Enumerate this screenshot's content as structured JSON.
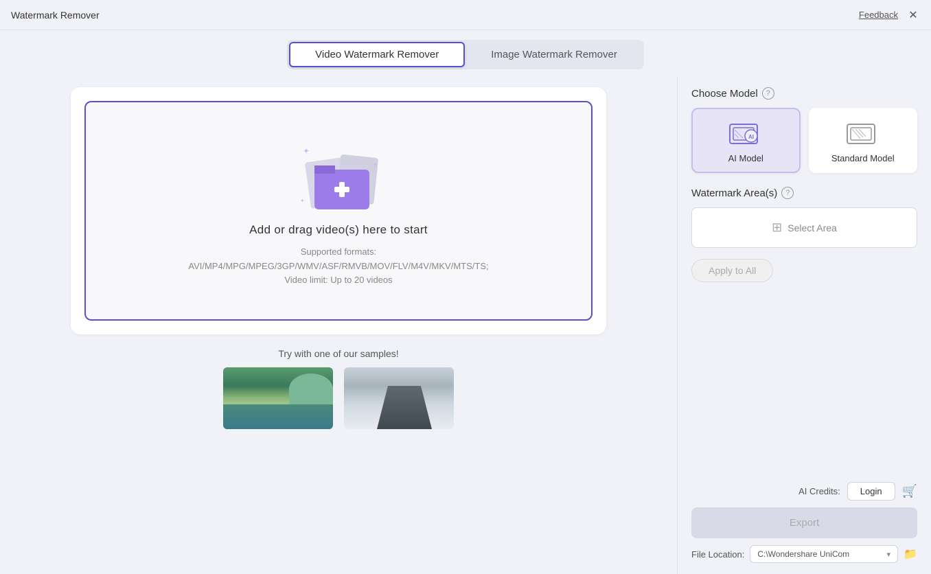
{
  "titleBar": {
    "title": "Watermark Remover",
    "feedback": "Feedback",
    "close": "✕"
  },
  "tabs": {
    "video": "Video Watermark Remover",
    "image": "Image Watermark Remover"
  },
  "activeTab": "video",
  "uploadZone": {
    "title": "Add or drag video(s) here to start",
    "formats_line1": "Supported formats:",
    "formats_line2": "AVI/MP4/MPG/MPEG/3GP/WMV/ASF/RMVB/MOV/FLV/M4V/MKV/MTS/TS;",
    "formats_line3": "Video limit: Up to 20 videos"
  },
  "samples": {
    "label": "Try with one of our samples!"
  },
  "rightPanel": {
    "chooseModel": "Choose Model",
    "watermarkArea": "Watermark Area(s)",
    "selectArea": "Select Area",
    "applyToAll": "Apply to All",
    "aiCredits": "AI Credits:",
    "login": "Login",
    "export": "Export",
    "fileLocation": "File Location:",
    "fileLocationValue": "C:\\Wondershare UniCom",
    "models": [
      {
        "label": "AI Model",
        "selected": true
      },
      {
        "label": "Standard Model",
        "selected": false
      }
    ]
  }
}
